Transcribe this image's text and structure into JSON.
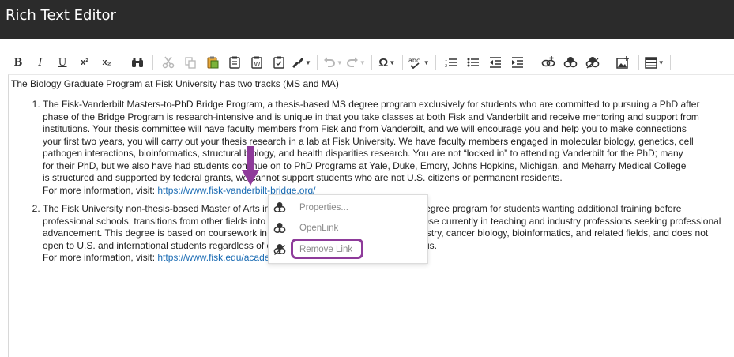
{
  "window": {
    "title": "Rich Text Editor"
  },
  "toolbar": {
    "bold": "B",
    "italic": "I",
    "underline": "U",
    "superscript": "x²",
    "subscript": "x₂",
    "omega": "Ω"
  },
  "document": {
    "intro": "The Biology Graduate Program at Fisk University has two tracks (MS and MA)",
    "items": [
      {
        "lines": [
          "The Fisk-Vanderbilt Masters-to-PhD Bridge Program, a thesis-based MS degree program exclusively for students who are committed to pursuing a PhD after",
          "phase of the Bridge Program is research-intensive and is unique in that you take classes at both Fisk and Vanderbilt and receive mentoring and support from",
          "institutions. Your thesis committee will have faculty members from Fisk and from Vanderbilt, and we will encourage you and help you to make connections",
          "your first two years, you will carry out your thesis research in a lab at Fisk University. We have faculty members engaged in molecular biology, genetics, cell",
          "pathogen interactions, bioinformatics, structural biology, and health disparities research. You are not “locked in” to attending Vanderbilt for the PhD; many",
          "for their PhD, but we also have had students continue on to PhD Programs at Yale, Duke, Emory, Johns Hopkins, Michigan, and Meharry Medical College",
          "is structured and supported by federal grants, we cannot support students who are not U.S. citizens or permanent residents."
        ],
        "more_prefix": "For more information, visit: ",
        "more_link": "https://www.fisk-vanderbilt-bridge.org/"
      },
      {
        "lines": [
          "The Fisk University non-thesis-based Master of Arts in Biology is a coursework-based MA degree program for students wanting additional training before",
          "professional schools, transitions from other fields into biology or biomedical science, and those currently in teaching and industry professions seeking professional",
          "advancement. This degree is based on coursework in molecular biology, genetics, biochemistry, cancer biology, bioinformatics, and related fields, and does not",
          "open to U.S. and international students regardless of citizenship or permanent resident status."
        ],
        "more_prefix": "For more information, visit: ",
        "more_link": "https://www.fisk.edu/academics/graduate-programs"
      }
    ]
  },
  "context_menu": {
    "items": [
      {
        "label": "Properties...",
        "icon": "link-icon"
      },
      {
        "label": "OpenLink",
        "icon": "link-icon"
      },
      {
        "label": "Remove Link",
        "icon": "unlink-icon"
      }
    ]
  },
  "annotation": {
    "highlight_color": "#8e3b9a",
    "arrow_color": "#8e3b9a"
  }
}
